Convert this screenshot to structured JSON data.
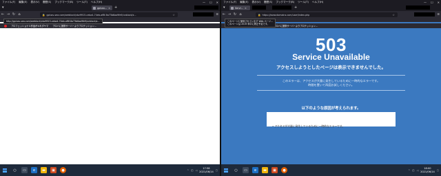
{
  "menu": [
    "ファイル(F)",
    "編集(E)",
    "表示(V)",
    "履歴(S)",
    "ブックマーク(B)",
    "ツール(T)",
    "ヘルプ(H)"
  ],
  "window_controls": [
    "—",
    "☐",
    "✕"
  ],
  "left": {
    "tab_title": "gplusv...",
    "url": "gplusv-sea.com/seeblock/vbz9915-ceba4-74eb-af8f-8a73b6aa9fe9/unblock/z...",
    "popup": [
      "http://gplusv-sea.com/seeblock/vbz9915-ceba4-74eb-af8f-8a73b6aa9fe9/unblock/z..."
    ],
    "banner": [
      "プロフェッショナル作品がキれダヤマ",
      "プロバに提携サーバーよりプロテッション..."
    ]
  },
  "right": {
    "tab_title": "Servi...",
    "url": "https://www.domainx.com/user/index.php",
    "popup": [
      "このページに使用されています Web ページ...",
      "このページは 2019 年中に修正予定です。"
    ],
    "banner": [
      "プロフェッショナル作品がキれダヤマ",
      "プロバに提携サーバーよりプロテッション..."
    ],
    "error": {
      "code": "503",
      "title": "Service Unavailable",
      "message": "アクセスしようとしたページは表示できませんでした。",
      "description": [
        "このエラーは、アクセスが大量に発生しているために一時的なエラーです。",
        "時間を置いて再度お試しください。"
      ],
      "causes_heading": "以下のような原因が考えられます。",
      "causes": [
        "アクセスが大量に発生しているために一時的なエラーです。"
      ]
    }
  },
  "taskbar": {
    "left_clock": [
      "17:58",
      "2021/06/14"
    ],
    "right_clock": [
      "18:00",
      "2021/06/14"
    ],
    "colors": {
      "bg": "#1e2a3b",
      "start": "#4aa3ff",
      "page_blue": "#3b79c0"
    }
  }
}
